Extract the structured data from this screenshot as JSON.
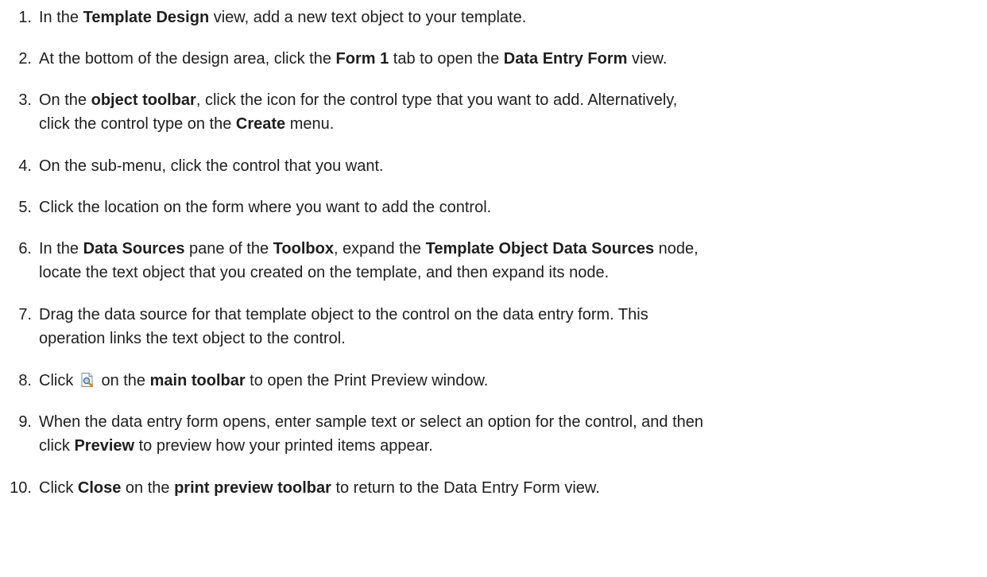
{
  "steps": [
    {
      "number": "1.",
      "parts": [
        {
          "t": "In the "
        },
        {
          "t": "Template Design",
          "b": true
        },
        {
          "t": " view, add a new text object to your template."
        }
      ]
    },
    {
      "number": "2.",
      "parts": [
        {
          "t": "At the bottom of the design area, click the "
        },
        {
          "t": "Form 1",
          "b": true
        },
        {
          "t": " tab to open the "
        },
        {
          "t": "Data Entry Form",
          "b": true
        },
        {
          "t": " view."
        }
      ]
    },
    {
      "number": "3.",
      "parts": [
        {
          "t": "On the "
        },
        {
          "t": "object toolbar",
          "b": true
        },
        {
          "t": ", click the icon for the control type that you want to add. Alternatively,"
        },
        {
          "br": true
        },
        {
          "t": "click the control type on the "
        },
        {
          "t": "Create",
          "b": true
        },
        {
          "t": " menu."
        }
      ]
    },
    {
      "number": "4.",
      "parts": [
        {
          "t": "On the sub-menu, click the control that you want."
        }
      ]
    },
    {
      "number": "5.",
      "parts": [
        {
          "t": "Click the location on the form where you want to add the control."
        }
      ]
    },
    {
      "number": "6.",
      "parts": [
        {
          "t": "In the "
        },
        {
          "t": "Data Sources",
          "b": true
        },
        {
          "t": " pane of the "
        },
        {
          "t": "Toolbox",
          "b": true
        },
        {
          "t": ", expand the "
        },
        {
          "t": "Template Object Data Sources",
          "b": true
        },
        {
          "t": " node,"
        },
        {
          "br": true
        },
        {
          "t": "locate the text object that you created on the template, and then expand its node."
        }
      ]
    },
    {
      "number": "7.",
      "parts": [
        {
          "t": "Drag the data source for that template object to the control on the data entry form. This"
        },
        {
          "br": true
        },
        {
          "t": "operation links the text object to the control."
        }
      ]
    },
    {
      "number": "8.",
      "parts": [
        {
          "t": "Click "
        },
        {
          "icon": "print-preview-icon"
        },
        {
          "t": " on the "
        },
        {
          "t": "main toolbar",
          "b": true
        },
        {
          "t": " to open the Print Preview window."
        }
      ]
    },
    {
      "number": "9.",
      "parts": [
        {
          "t": "When the data entry form opens, enter sample text or select an option for the control, and then"
        },
        {
          "br": true
        },
        {
          "t": "click "
        },
        {
          "t": "Preview",
          "b": true
        },
        {
          "t": " to preview how your printed items appear."
        }
      ]
    },
    {
      "number": "10.",
      "parts": [
        {
          "t": "Click "
        },
        {
          "t": "Close",
          "b": true
        },
        {
          "t": " on the "
        },
        {
          "t": "print preview toolbar",
          "b": true
        },
        {
          "t": " to return to the Data Entry Form view."
        }
      ]
    }
  ]
}
